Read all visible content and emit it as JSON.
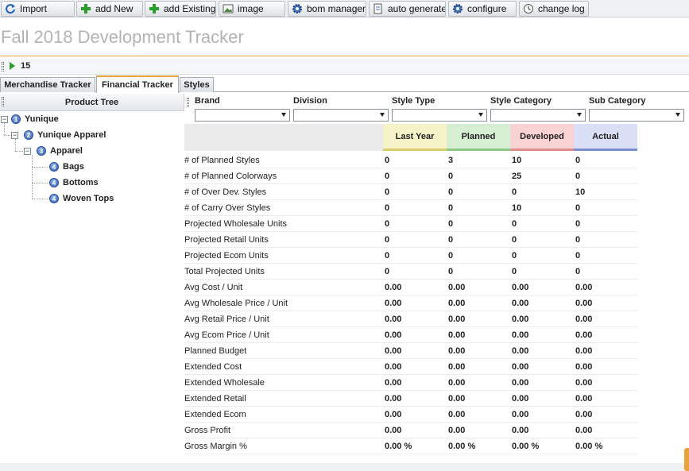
{
  "toolbar": {
    "buttons": [
      {
        "label": "Import",
        "icon": "refresh-icon"
      },
      {
        "label": "add New",
        "icon": "plus-icon"
      },
      {
        "label": "add Existing",
        "icon": "plus-icon"
      },
      {
        "label": "image",
        "icon": "image-icon"
      },
      {
        "label": "bom manager",
        "icon": "gear-icon"
      },
      {
        "label": "auto generate",
        "icon": "document-icon"
      },
      {
        "label": "configure",
        "icon": "gear-icon"
      },
      {
        "label": "change log",
        "icon": "clock-icon"
      }
    ]
  },
  "page": {
    "title": "Fall 2018 Development Tracker",
    "accent_color": "#e9a23b",
    "record_number": "15"
  },
  "tabs": [
    {
      "label": "Merchandise Tracker",
      "active": false
    },
    {
      "label": "Financial Tracker",
      "active": true
    },
    {
      "label": "Styles",
      "active": false
    }
  ],
  "tree": {
    "header": "Product Tree",
    "nodes": [
      {
        "level": "1",
        "label": "Yunique"
      },
      {
        "level": "2",
        "label": "Yunique Apparel"
      },
      {
        "level": "3",
        "label": "Apparel"
      },
      {
        "level": "4",
        "label": "Bags"
      },
      {
        "level": "4",
        "label": "Bottoms"
      },
      {
        "level": "4",
        "label": "Woven Tops"
      }
    ]
  },
  "filters": [
    {
      "label": "Brand",
      "value": ""
    },
    {
      "label": "Division",
      "value": ""
    },
    {
      "label": "Style Type",
      "value": ""
    },
    {
      "label": "Style Category",
      "value": ""
    },
    {
      "label": "Sub Category",
      "value": ""
    }
  ],
  "grid": {
    "columns": [
      {
        "label": "Last Year",
        "bg": "#f7f3c9",
        "accent": "#d8cf6a"
      },
      {
        "label": "Planned",
        "bg": "#d6efd2",
        "accent": "#8dc886"
      },
      {
        "label": "Developed",
        "bg": "#f9d3d3",
        "accent": "#e28c8c"
      },
      {
        "label": "Actual",
        "bg": "#d9dff4",
        "accent": "#7b8fd0"
      }
    ],
    "rows": [
      {
        "label": "# of Planned Styles",
        "values": [
          "0",
          "3",
          "10",
          "0"
        ]
      },
      {
        "label": "# of Planned Colorways",
        "values": [
          "0",
          "0",
          "25",
          "0"
        ]
      },
      {
        "label": "# of Over Dev. Styles",
        "values": [
          "0",
          "0",
          "0",
          "10"
        ]
      },
      {
        "label": "# of Carry Over Styles",
        "values": [
          "0",
          "0",
          "10",
          "0"
        ]
      },
      {
        "label": "Projected Wholesale Units",
        "values": [
          "0",
          "0",
          "0",
          "0"
        ]
      },
      {
        "label": "Projected Retail Units",
        "values": [
          "0",
          "0",
          "0",
          "0"
        ]
      },
      {
        "label": "Projected Ecom Units",
        "values": [
          "0",
          "0",
          "0",
          "0"
        ]
      },
      {
        "label": "Total Projected Units",
        "values": [
          "0",
          "0",
          "0",
          "0"
        ]
      },
      {
        "label": "Avg Cost / Unit",
        "values": [
          "0.00",
          "0.00",
          "0.00",
          "0.00"
        ]
      },
      {
        "label": "Avg Wholesale Price / Unit",
        "values": [
          "0.00",
          "0.00",
          "0.00",
          "0.00"
        ]
      },
      {
        "label": "Avg Retail Price / Unit",
        "values": [
          "0.00",
          "0.00",
          "0.00",
          "0.00"
        ]
      },
      {
        "label": "Avg Ecom Price / Unit",
        "values": [
          "0.00",
          "0.00",
          "0.00",
          "0.00"
        ]
      },
      {
        "label": "Planned Budget",
        "values": [
          "0.00",
          "0.00",
          "0.00",
          "0.00"
        ]
      },
      {
        "label": "Extended Cost",
        "values": [
          "0.00",
          "0.00",
          "0.00",
          "0.00"
        ]
      },
      {
        "label": "Extended Wholesale",
        "values": [
          "0.00",
          "0.00",
          "0.00",
          "0.00"
        ]
      },
      {
        "label": "Extended Retail",
        "values": [
          "0.00",
          "0.00",
          "0.00",
          "0.00"
        ]
      },
      {
        "label": "Extended Ecom",
        "values": [
          "0.00",
          "0.00",
          "0.00",
          "0.00"
        ]
      },
      {
        "label": "Gross Profit",
        "values": [
          "0.00",
          "0.00",
          "0.00",
          "0.00"
        ]
      },
      {
        "label": "Gross Margin %",
        "values": [
          "0.00 %",
          "0.00 %",
          "0.00 %",
          "0.00 %"
        ]
      }
    ]
  }
}
